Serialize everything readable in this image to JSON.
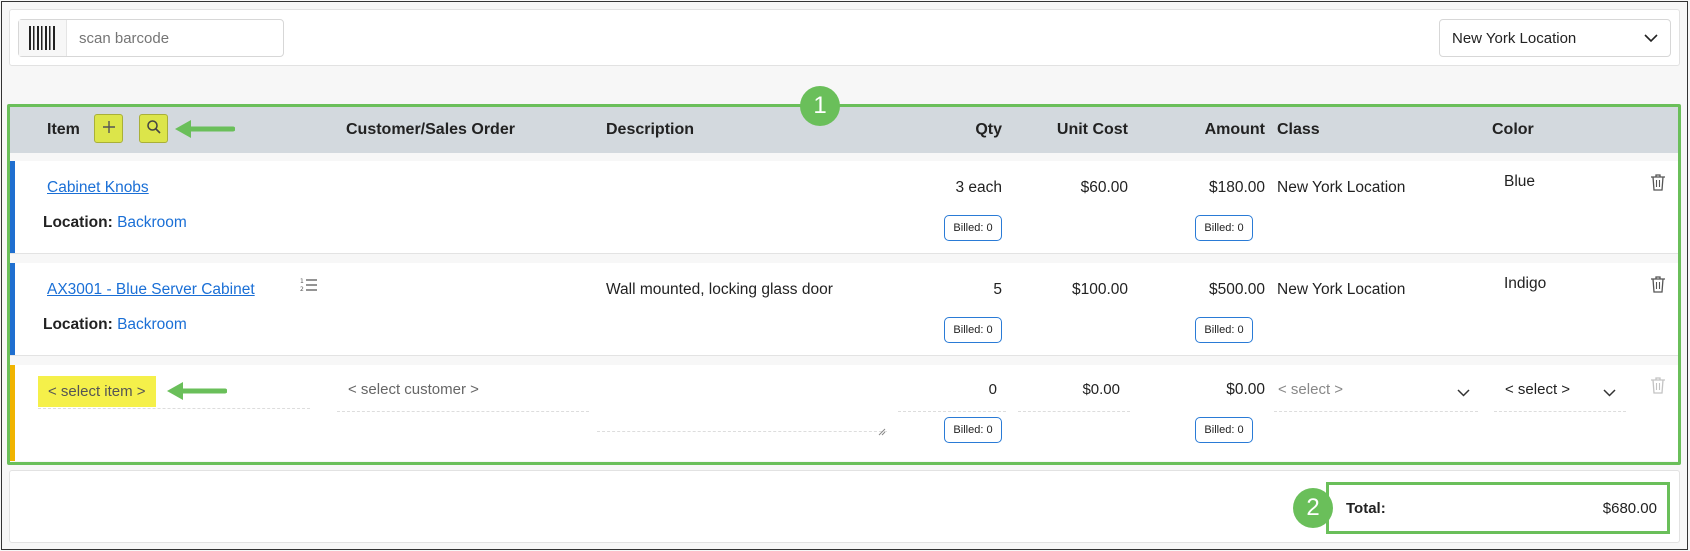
{
  "top": {
    "scan_placeholder": "scan barcode",
    "location_select": "New York Location"
  },
  "callouts": {
    "one": "1",
    "two": "2"
  },
  "columns": {
    "item": "Item",
    "customer": "Customer/Sales Order",
    "description": "Description",
    "qty": "Qty",
    "unit_cost": "Unit Cost",
    "amount": "Amount",
    "class": "Class",
    "color": "Color"
  },
  "rows": [
    {
      "item": "Cabinet Knobs",
      "location_label": "Location:",
      "location": "Backroom",
      "description": "",
      "qty": "3 each",
      "unit_cost": "$60.00",
      "amount": "$180.00",
      "class": "New York Location",
      "color": "Blue",
      "billed_qty": "Billed: 0",
      "billed_amount": "Billed: 0",
      "bar_color": "#1f6fd0"
    },
    {
      "item": "AX3001 - Blue Server Cabinet",
      "location_label": "Location:",
      "location": "Backroom",
      "description": "Wall mounted, locking glass door",
      "qty": "5",
      "unit_cost": "$100.00",
      "amount": "$500.00",
      "class": "New York Location",
      "color": "Indigo",
      "billed_qty": "Billed: 0",
      "billed_amount": "Billed: 0",
      "bar_color": "#1f6fd0"
    }
  ],
  "new_row": {
    "item_placeholder": "< select item >",
    "customer_placeholder": "< select customer >",
    "qty": "0",
    "unit_cost": "$0.00",
    "amount": "$0.00",
    "class_placeholder": "< select >",
    "color_placeholder": "< select >",
    "billed_qty": "Billed: 0",
    "billed_amount": "Billed: 0",
    "bar_color": "#f0b400"
  },
  "footer": {
    "total_label": "Total:",
    "total_value": "$680.00"
  },
  "colors": {
    "accent_green": "#6abf5a",
    "highlight_yellow": "#f5f04a",
    "link_blue": "#1a6fd6"
  }
}
